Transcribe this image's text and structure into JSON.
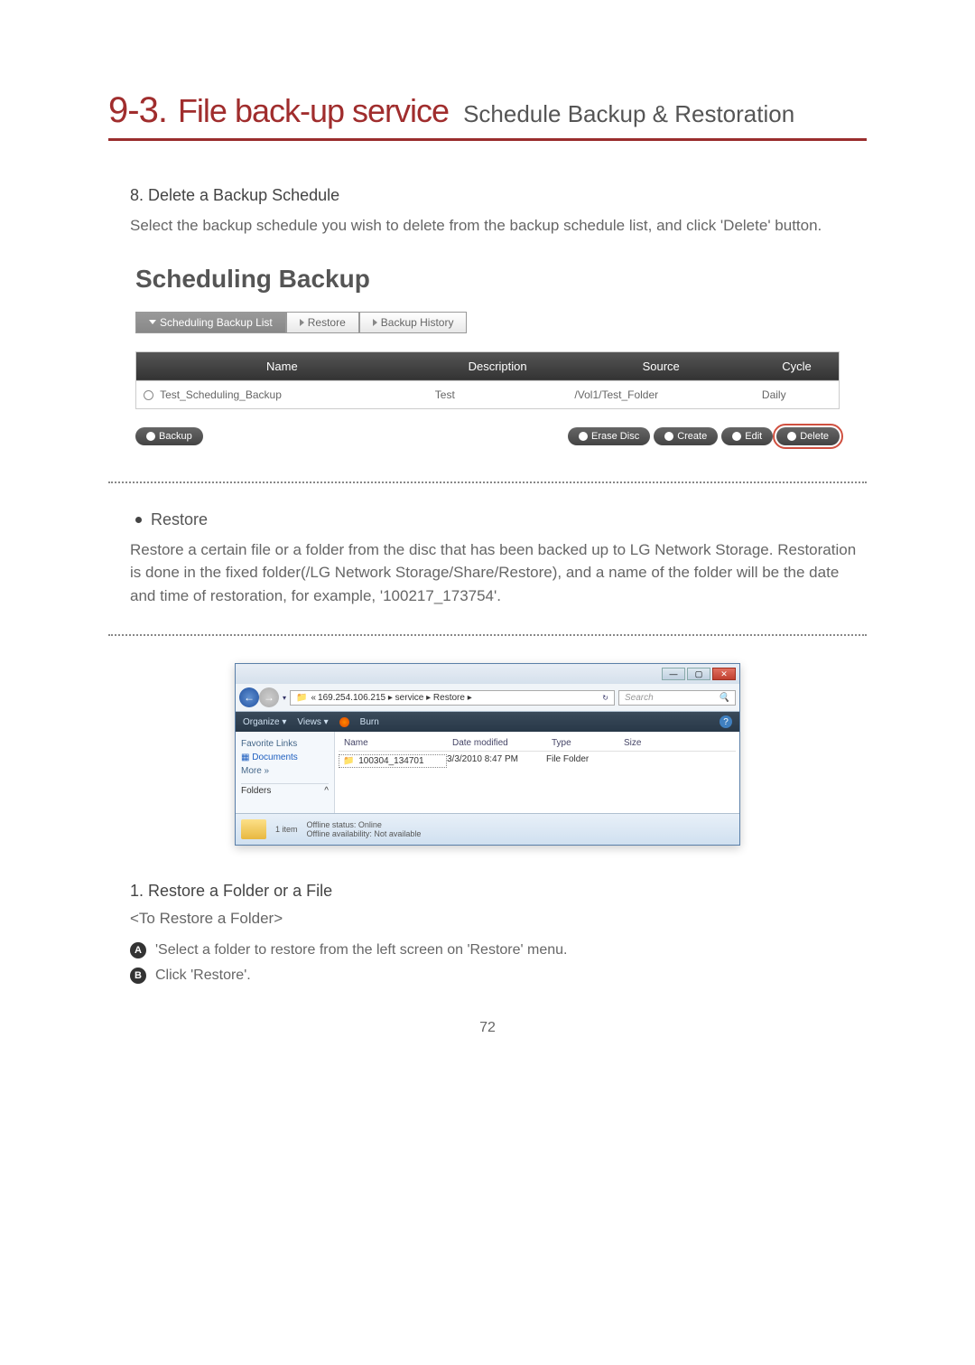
{
  "chapter": {
    "num": "9-3.",
    "title": "File back-up service",
    "subtitle": "Schedule Backup & Restoration"
  },
  "section8": {
    "title": "8. Delete a Backup Schedule",
    "body": "Select the backup schedule you wish to delete from the backup schedule list, and click 'Delete' button."
  },
  "sb": {
    "title": "Scheduling Backup",
    "tabs": {
      "list": "Scheduling Backup List",
      "restore": "Restore",
      "history": "Backup History"
    },
    "headers": {
      "name": "Name",
      "description": "Description",
      "source": "Source",
      "cycle": "Cycle"
    },
    "row": {
      "name": "Test_Scheduling_Backup",
      "description": "Test",
      "source": "/Vol1/Test_Folder",
      "cycle": "Daily"
    },
    "buttons": {
      "backup": "Backup",
      "erase": "Erase Disc",
      "create": "Create",
      "edit": "Edit",
      "delete": "Delete"
    }
  },
  "restore": {
    "title": "Restore",
    "body": "Restore a certain file or a folder from the disc that has been backed up to LG Network Storage. Restoration is done in the fixed folder(/LG Network Storage/Share/Restore), and a name of the folder will be the date and time of restoration, for example, '100217_173754'."
  },
  "explorer": {
    "breadcrumb_prefix": "«",
    "breadcrumb": "169.254.106.215 ▸ service ▸ Restore ▸",
    "search_placeholder": "Search",
    "toolbar": {
      "organize": "Organize ▾",
      "views": "Views ▾",
      "burn": "Burn"
    },
    "sidebar": {
      "favorite": "Favorite Links",
      "documents": "Documents",
      "more": "More »",
      "folders": "Folders"
    },
    "columns": {
      "name": "Name",
      "date": "Date modified",
      "type": "Type",
      "size": "Size"
    },
    "row": {
      "name": "100304_134701",
      "date": "3/3/2010 8:47 PM",
      "type": "File Folder",
      "size": ""
    },
    "status": {
      "count": "1 item",
      "line1": "Offline status: Online",
      "line2": "Offline availability: Not available"
    }
  },
  "section1": {
    "title": "1. Restore a Folder or a File",
    "sub": "<To Restore a Folder>",
    "a": "'Select a folder to restore from the left screen on 'Restore' menu.",
    "b": "Click 'Restore'."
  },
  "page_number": "72"
}
